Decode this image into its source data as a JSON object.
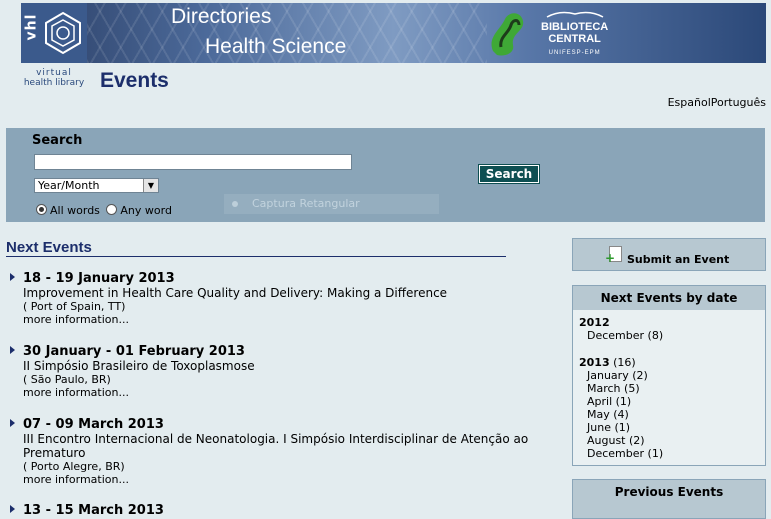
{
  "header": {
    "vhl_vertical": "vhl",
    "title_line1": "Directories",
    "title_line2": "Health Science",
    "bc_line1": "BIBLIOTECA",
    "bc_line2": "CENTRAL",
    "bc_sub": "UNIFESP-EPM"
  },
  "vhl": {
    "line1": "virtual",
    "line2": "health library"
  },
  "page_title": "Events",
  "languages": [
    "Español",
    "Português"
  ],
  "search": {
    "label": "Search",
    "input_value": "",
    "select_value": "Year/Month",
    "radio_all": "All words",
    "radio_any": "Any word",
    "button": "Search",
    "overlay_text": "Captura Retangular"
  },
  "next_events_title": "Next Events",
  "events": [
    {
      "date": "18 - 19 January 2013",
      "title": "Improvement in Health Care Quality and Delivery: Making a Difference",
      "location": "( Port of Spain, TT)",
      "more": "more information..."
    },
    {
      "date": "30 January - 01 February 2013",
      "title": "II Simpósio Brasileiro de Toxoplasmose",
      "location": "( São Paulo, BR)",
      "more": "more information..."
    },
    {
      "date": "07 - 09 March 2013",
      "title": "III Encontro Internacional de Neonatologia. I Simpósio Interdisciplinar de Atenção ao Prematuro",
      "location": "( Porto Alegre, BR)",
      "more": "more information..."
    },
    {
      "date": "13 - 15 March 2013"
    }
  ],
  "sidebar": {
    "submit_label": "Submit an Event",
    "by_date_title": "Next Events by date",
    "years": [
      {
        "year": "2012",
        "count": "",
        "months": [
          "December (8)"
        ]
      },
      {
        "year": "2013",
        "count": " (16)",
        "months": [
          "January (2)",
          "March (5)",
          "April (1)",
          "May (4)",
          "June (1)",
          "August (2)",
          "December (1)"
        ]
      }
    ],
    "previous_title": "Previous Events"
  }
}
